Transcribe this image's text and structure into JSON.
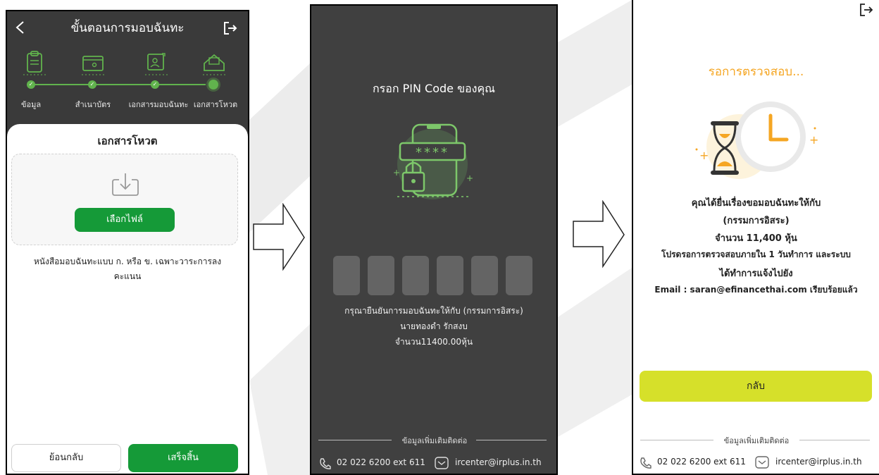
{
  "screen1": {
    "title": "ขั้นตอนการมอบฉันทะ",
    "steps": [
      {
        "label": "ข้อมูล",
        "icon": "clipboard-icon"
      },
      {
        "label": "สำเนาบัตร",
        "icon": "id-card-icon"
      },
      {
        "label": "เอกสารมอบฉันทะ",
        "icon": "proxy-document-icon"
      },
      {
        "label": "เอกสารโหวต",
        "icon": "ballot-box-icon"
      }
    ],
    "section_title": "เอกสารโหวต",
    "upload_button": "เลือกไฟล์",
    "description": "หนังสือมอบฉันทะแบบ ก. หรือ ข. เฉพาะวาระการลง",
    "description2": "คะแนน",
    "back_button": "ย้อนกลับ",
    "finish_button": "เสร็จสิ้น"
  },
  "screen2": {
    "title": "กรอก PIN Code ของคุณ",
    "pin_mask": "****",
    "confirm_line1": "กรุณายืนยันการมอบฉันทะให้กับ (กรรมการอิสระ)",
    "confirm_line2": "นายทองดำ รักสงบ",
    "confirm_line3": "จำนวน11400.00หุ้น",
    "contact_heading": "ข้อมูลเพิ่มเติมติดต่อ",
    "phone": "02 022 6200 ext 611",
    "email": "ircenter@irplus.in.th"
  },
  "screen3": {
    "status": "รอการตรวจสอบ...",
    "line1": "คุณได้ยื่นเรื่องขอมอบฉันทะให้กับ",
    "line2": "(กรรมการอิสระ)",
    "line3": "จำนวน 11,400 หุ้น",
    "line4": "โปรดรอการตรวจสอบภายใน 1 วันทำการ และระบบ",
    "line5": "ได้ทำการแจ้งไปยัง",
    "line6": "Email : saran@efinancethai.com เรียบร้อยแล้ว",
    "back_button": "กลับ",
    "contact_heading": "ข้อมูลเพิ่มเติมติดต่อ",
    "phone": "02 022 6200 ext 611",
    "email": "ircenter@irplus.in.th"
  },
  "colors": {
    "green": "#159a38",
    "step_green": "#61b34d",
    "orange": "#f5a623",
    "lime_button": "#d6e02a"
  }
}
